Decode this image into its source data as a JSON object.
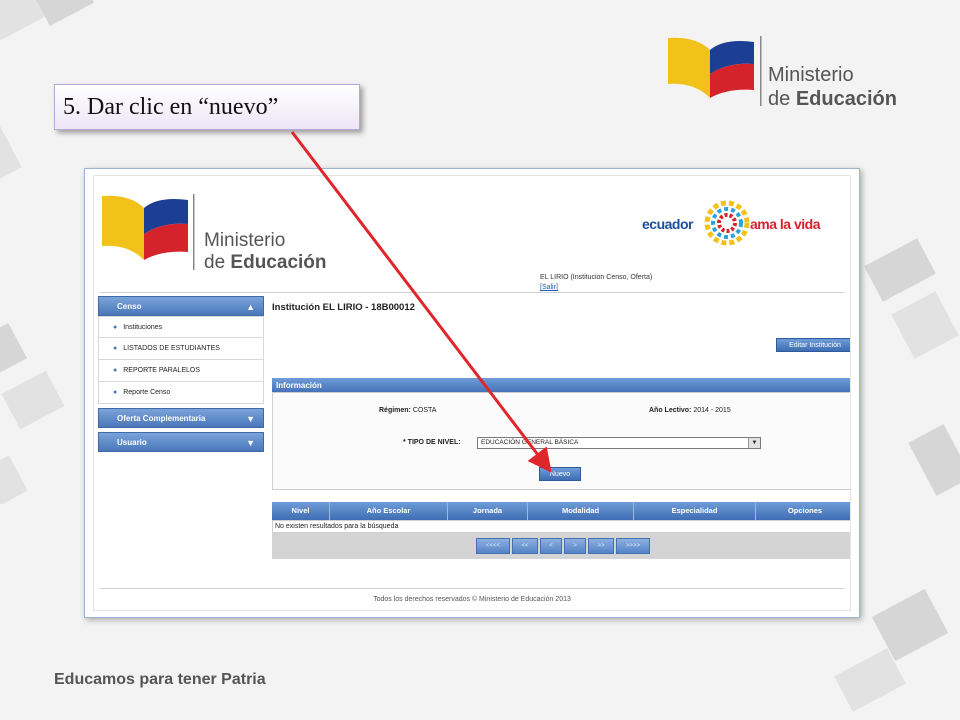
{
  "slide": {
    "callout": "5. Dar clic en “nuevo”",
    "logo_line1": "Ministerio",
    "logo_line2_prefix": "de ",
    "logo_line2_bold": "Educación",
    "tagline": "Educamos para tener Patria"
  },
  "app": {
    "logo_line1": "Ministerio",
    "logo_line2_prefix": "de ",
    "logo_line2_bold": "Educación",
    "eco_left": "ecuador",
    "eco_right": "ama la vida",
    "user_info": "EL LIRIO (Institucion Censo, Oferta)",
    "logout_link": "[Salir]",
    "sidebar": {
      "sections": [
        {
          "label": "Censo",
          "expanded": true,
          "chevron": "▲"
        },
        {
          "label": "Oferta Complementaria",
          "expanded": false,
          "chevron": "▼"
        },
        {
          "label": "Usuario",
          "expanded": false,
          "chevron": "▼"
        }
      ],
      "censo_items": [
        "Instituciones",
        "LISTADOS DE ESTUDIANTES",
        "REPORTE PARALELOS",
        "Reporte Censo"
      ]
    },
    "main": {
      "title": "Institución EL LIRIO - 18B00012",
      "edit_button": "Editar Institución",
      "info_header": "Información",
      "regimen_label": "Régimen:",
      "regimen_value": "COSTA",
      "anio_label": "Año Lectivo:",
      "anio_value": "2014 - 2015",
      "tipo_label": "* TIPO DE NIVEL:",
      "tipo_value": "EDUCACIÓN GENERAL BÁSICA",
      "nuevo_button": "Nuevo",
      "table_columns": [
        "Nivel",
        "Año Escolar",
        "Jornada",
        "Modalidad",
        "Especialidad",
        "Opciones"
      ],
      "empty_message": "No existen resultados para la búsqueda",
      "pager": [
        "<<<<",
        "<<",
        "<",
        ">",
        ">>",
        ">>>>"
      ]
    },
    "footer": "Todos los derechos reservados © Ministerio de Educación 2013"
  },
  "colors": {
    "accent_blue": "#3e6db3",
    "flag_yellow": "#f2c21a",
    "flag_blue": "#1c3f94",
    "flag_red": "#d4232b",
    "arrow_red": "#e0252b"
  }
}
